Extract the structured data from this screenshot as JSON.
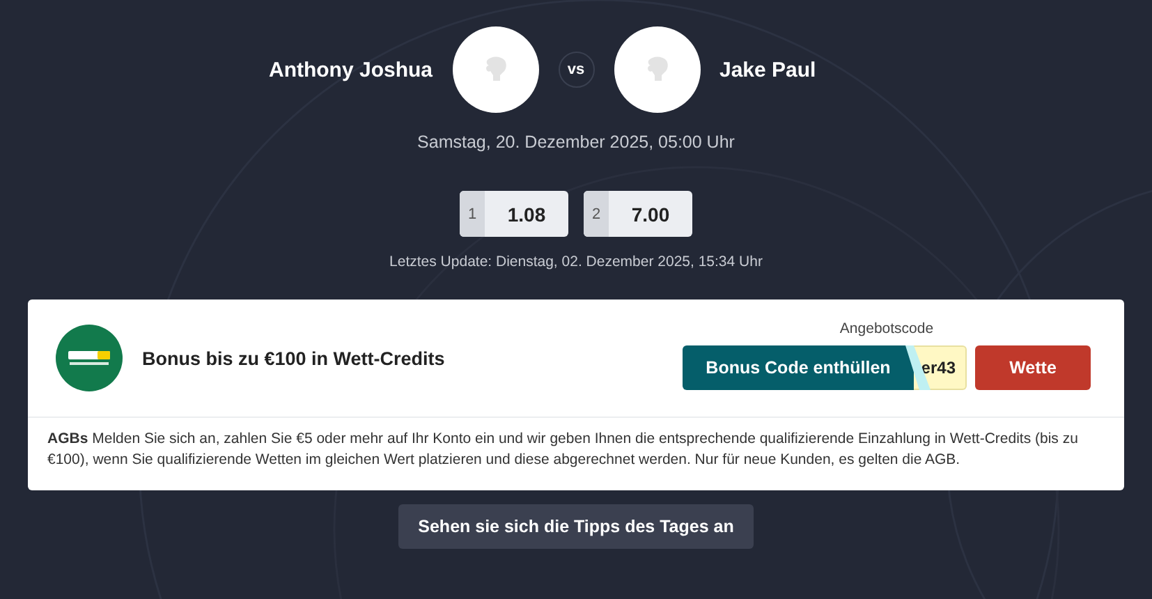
{
  "match": {
    "home": {
      "name": "Anthony Joshua"
    },
    "vs": "vs",
    "away": {
      "name": "Jake Paul"
    },
    "date": "Samstag, 20. Dezember 2025, 05:00 Uhr"
  },
  "odds": [
    {
      "label": "1",
      "value": "1.08"
    },
    {
      "label": "2",
      "value": "7.00"
    }
  ],
  "last_update": "Letztes Update: Dienstag, 02. Dezember 2025, 15:34 Uhr",
  "offer": {
    "title": "Bonus bis zu €100 in Wett-Credits",
    "code_label": "Angebotscode",
    "reveal_button": "Bonus Code enthüllen",
    "code_peek": "er43",
    "bet_button": "Wette",
    "terms": "**AGBs** Melden Sie sich an, zahlen Sie €5 oder mehr auf Ihr Konto ein und wir geben Ihnen die entsprechende qualifizierende Einzahlung in Wett-Credits (bis zu €100), wenn Sie qualifizierende Wetten im gleichen Wert platzieren und diese abgerechnet werden. Nur für neue Kunden, es gelten die AGB."
  },
  "tips_button": "Sehen sie sich die Tipps des Tages an"
}
